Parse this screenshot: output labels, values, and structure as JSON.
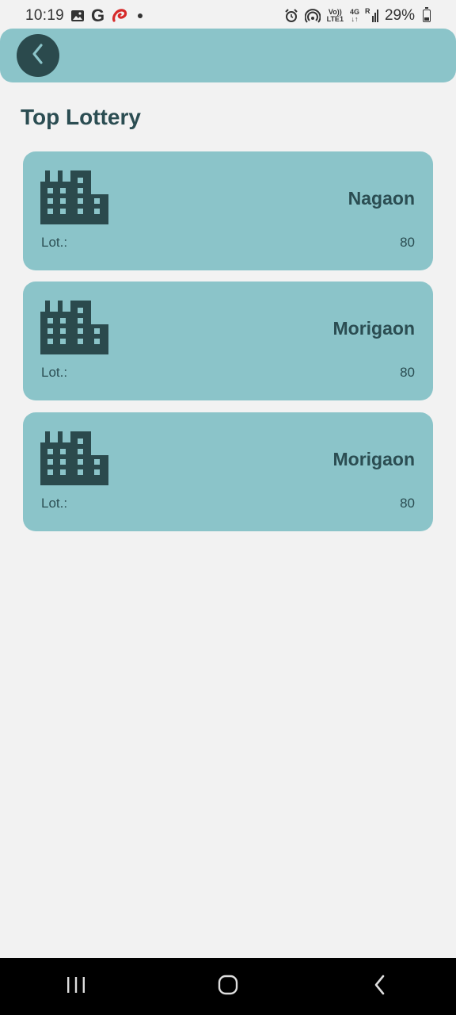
{
  "status_bar": {
    "time": "10:19",
    "g_letter": "G",
    "vol_line1": "Vo))",
    "vol_line2": "LTE1",
    "net_type": "4G",
    "roaming": "R",
    "battery": "29%"
  },
  "page": {
    "title": "Top Lottery"
  },
  "cards": [
    {
      "city": "Nagaon",
      "lot_label": "Lot.:",
      "lot_value": "80"
    },
    {
      "city": "Morigaon",
      "lot_label": "Lot.:",
      "lot_value": "80"
    },
    {
      "city": "Morigaon",
      "lot_label": "Lot.:",
      "lot_value": "80"
    }
  ],
  "colors": {
    "accent": "#8bc4c9",
    "dark": "#2b4a4d",
    "background": "#f2f2f2"
  },
  "icons": {
    "back": "chevron-left-icon",
    "card": "building-icon",
    "nav_recents": "recents-icon",
    "nav_home": "home-icon",
    "nav_back": "nav-back-icon"
  }
}
